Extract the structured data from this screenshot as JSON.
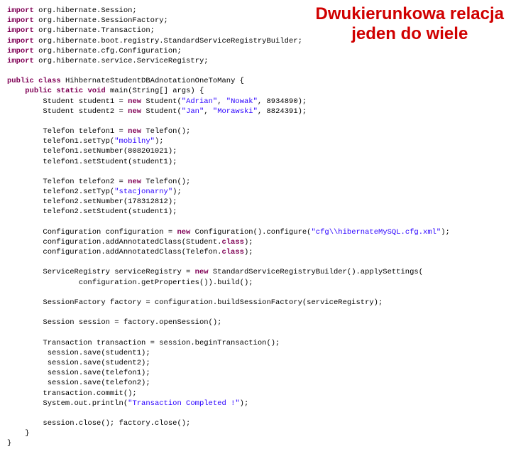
{
  "title": {
    "line1": "Dwukierunkowa relacja",
    "line2": "jeden do wiele"
  },
  "kw": {
    "import": "import",
    "public": "public",
    "class": "class",
    "static": "static",
    "void": "void",
    "new": "new"
  },
  "imp": {
    "i1": " org.hibernate.Session;",
    "i2": " org.hibernate.SessionFactory;",
    "i3": " org.hibernate.Transaction;",
    "i4": " org.hibernate.boot.registry.StandardServiceRegistryBuilder;",
    "i5": " org.hibernate.cfg.Configuration;",
    "i6": " org.hibernate.service.ServiceRegistry;"
  },
  "cls": {
    "decl": " HihbernateStudentDBAdnotationOneToMany {",
    "mainSig": " main(String[] args) {"
  },
  "s1": {
    "a": "        Student student1 = ",
    "b": " Student(",
    "str1": "\"Adrian\"",
    "c": ", ",
    "str2": "\"Nowak\"",
    "d": ", 8934890);"
  },
  "s2": {
    "a": "        Student student2 = ",
    "b": " Student(",
    "str1": "\"Jan\"",
    "c": ", ",
    "str2": "\"Morawski\"",
    "d": ", 8824391);"
  },
  "t1": {
    "decl_a": "        Telefon telefon1 = ",
    "decl_b": " Telefon();",
    "typ_a": "        telefon1.setTyp(",
    "typ_s": "\"mobilny\"",
    "typ_b": ");",
    "num": "        telefon1.setNumber(808201021);",
    "stu": "        telefon1.setStudent(student1);"
  },
  "t2": {
    "decl_a": "        Telefon telefon2 = ",
    "decl_b": " Telefon();",
    "typ_a": "        telefon2.setTyp(",
    "typ_s": "\"stacjonarny\"",
    "typ_b": ");",
    "num": "        telefon2.setNumber(178312812);",
    "stu": "        telefon2.setStudent(student1);"
  },
  "cfg": {
    "a": "        Configuration configuration = ",
    "b": " Configuration().configure(",
    "s": "\"cfg\\\\hibernateMySQL.cfg.xml\"",
    "c": ");",
    "ann1a": "        configuration.addAnnotatedClass(Student.",
    "ann1b": ");",
    "ann2a": "        configuration.addAnnotatedClass(Telefon.",
    "ann2b": ");",
    "classkw": "class"
  },
  "sr": {
    "a": "        ServiceRegistry serviceRegistry = ",
    "b": " StandardServiceRegistryBuilder().applySettings(",
    "c": "                configuration.getProperties()).build();"
  },
  "sf": "        SessionFactory factory = configuration.buildSessionFactory(serviceRegistry);",
  "ses": "        Session session = factory.openSession();",
  "tx": {
    "begin": "        Transaction transaction = session.beginTransaction();",
    "s1": "         session.save(student1);",
    "s2": "         session.save(student2);",
    "s3": "         session.save(telefon1);",
    "s4": "         session.save(telefon2);",
    "commit": "        transaction.commit();"
  },
  "out": {
    "a": "        System.out.println(",
    "s": "\"Transaction Completed !\"",
    "b": ");"
  },
  "close": "        session.close(); factory.close();",
  "brace1": "    }",
  "brace2": "}"
}
